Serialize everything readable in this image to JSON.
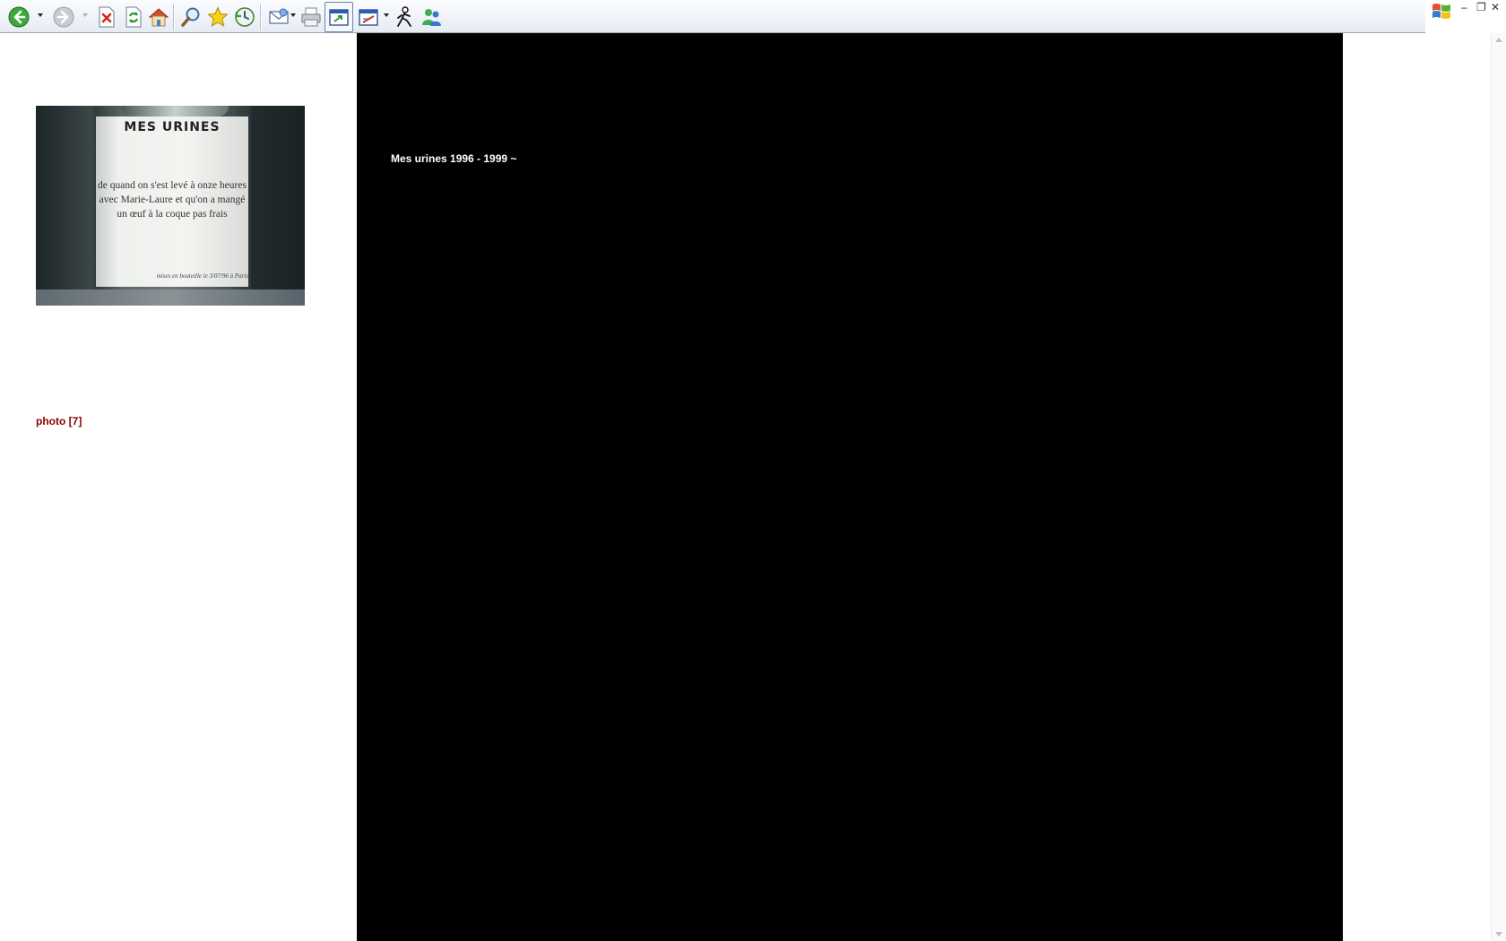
{
  "toolbar": {
    "buttons": [
      {
        "name": "back-button",
        "icon": "back-arrow-icon"
      },
      {
        "name": "forward-button",
        "icon": "forward-arrow-icon"
      },
      {
        "name": "stop-button",
        "icon": "stop-icon"
      },
      {
        "name": "refresh-button",
        "icon": "refresh-icon"
      },
      {
        "name": "home-button",
        "icon": "home-icon"
      },
      {
        "name": "search-button",
        "icon": "magnifier-icon"
      },
      {
        "name": "favorites-button",
        "icon": "star-icon"
      },
      {
        "name": "history-button",
        "icon": "history-icon"
      },
      {
        "name": "mail-button",
        "icon": "mail-icon"
      },
      {
        "name": "print-button",
        "icon": "printer-icon"
      },
      {
        "name": "fullscreen-button",
        "icon": "window-icon"
      },
      {
        "name": "edit-button",
        "icon": "edit-icon"
      },
      {
        "name": "messenger-button",
        "icon": "messenger-person-icon"
      },
      {
        "name": "contacts-button",
        "icon": "contacts-icon"
      }
    ]
  },
  "window_controls": {
    "minimize": "–",
    "restore": "❐",
    "close": "✕"
  },
  "content": {
    "photo": {
      "label_title": "MES URINES",
      "label_lines": [
        "de quand on s'est levé à onze heures",
        "avec Marie-Laure et qu'on a mangé",
        "un œuf à la coque pas frais"
      ],
      "label_signature": "mises en bouteille le 3/07/96 à Paris"
    },
    "photo_link": "photo [7]",
    "panel_title": "Mes urines 1996 - 1999 ~"
  },
  "colors": {
    "link": "#8b0000",
    "panel_background": "#000000",
    "panel_text": "#ffffff"
  }
}
